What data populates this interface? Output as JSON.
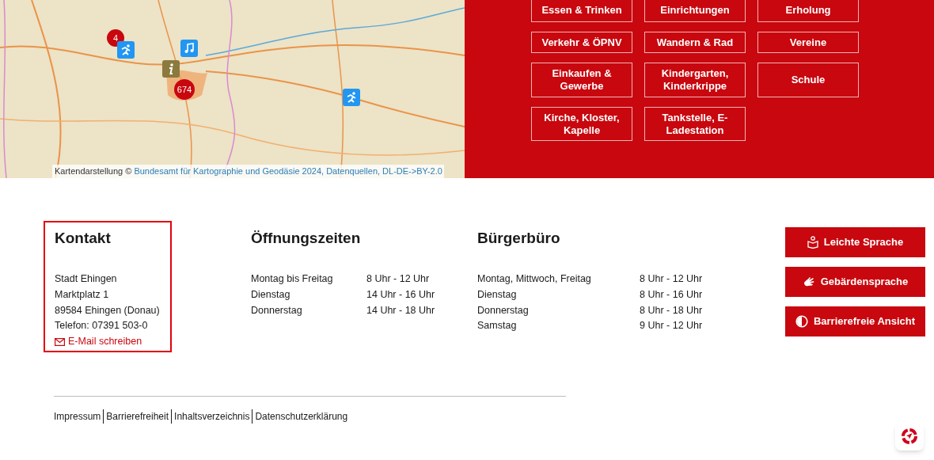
{
  "map": {
    "markers": [
      {
        "kind": "cluster",
        "label": "4"
      },
      {
        "kind": "sport"
      },
      {
        "kind": "music"
      },
      {
        "kind": "info"
      },
      {
        "kind": "cluster",
        "label": "674"
      },
      {
        "kind": "sport"
      }
    ],
    "attribution": {
      "prefix": "Kartendarstellung ©",
      "link": "Bundesamt für Kartographie und Geodäsie 2024, Datenquellen, DL-DE->BY-2.0"
    }
  },
  "categories": [
    "Essen & Trinken",
    "Einrichtungen",
    "Erholung",
    "Verkehr & ÖPNV",
    "Wandern & Rad",
    "Vereine",
    "Einkaufen & Gewerbe",
    "Kindergarten, Kinderkrippe",
    "Schule",
    "Kirche, Kloster, Kapelle",
    "Tankstelle, E-Ladestation"
  ],
  "contact": {
    "heading": "Kontakt",
    "highlighted": true,
    "lines": [
      "Stadt Ehingen",
      "Marktplatz 1",
      "89584 Ehingen (Donau)",
      "Telefon: 07391 503-0"
    ],
    "email": "E-Mail schreiben"
  },
  "hours": [
    {
      "heading": "Öffnungszeiten",
      "rows": [
        {
          "day": "Montag bis Freitag",
          "time": "8 Uhr - 12 Uhr"
        },
        {
          "day": "Dienstag",
          "time": "14 Uhr - 16 Uhr"
        },
        {
          "day": "Donnerstag",
          "time": "14 Uhr - 18 Uhr"
        }
      ]
    },
    {
      "heading": "Bürgerbüro",
      "rows": [
        {
          "day": "Montag, Mittwoch, Freitag",
          "time": "8 Uhr - 12 Uhr"
        },
        {
          "day": "Dienstag",
          "time": "8 Uhr - 16 Uhr"
        },
        {
          "day": "Donnerstag",
          "time": "8 Uhr - 18 Uhr"
        },
        {
          "day": "Samstag",
          "time": "9 Uhr - 12 Uhr"
        }
      ]
    }
  ],
  "accessibility": [
    {
      "kind": "easy_language",
      "label": "Leichte Sprache"
    },
    {
      "kind": "sign_language",
      "label": "Gebärdensprache"
    },
    {
      "kind": "contrast",
      "label": "Barrierefreie Ansicht"
    }
  ],
  "footer_links": [
    "Impressum",
    "Barrierefreiheit",
    "Inhaltsverzeichnis",
    "Datenschutzerklärung"
  ]
}
